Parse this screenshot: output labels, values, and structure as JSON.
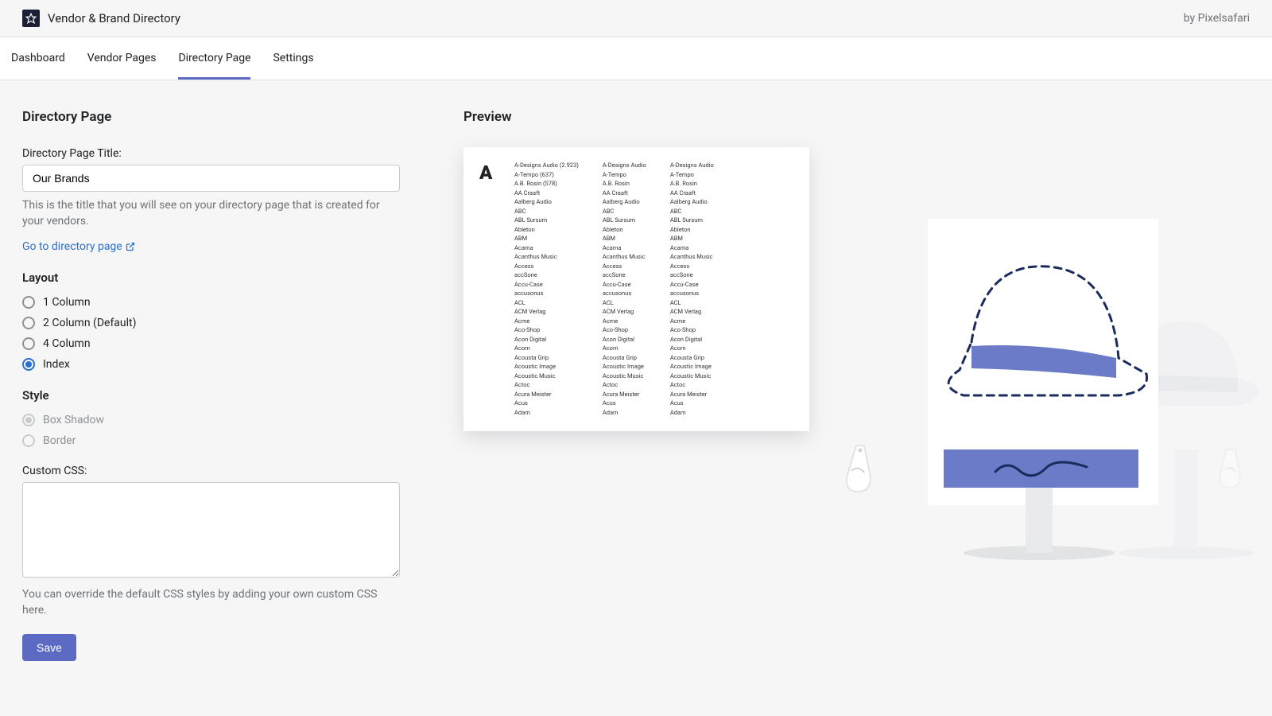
{
  "header": {
    "app_title": "Vendor & Brand Directory",
    "byline": "by Pixelsafari"
  },
  "tabs": [
    {
      "label": "Dashboard"
    },
    {
      "label": "Vendor Pages"
    },
    {
      "label": "Directory Page"
    },
    {
      "label": "Settings"
    }
  ],
  "active_tab": 2,
  "page": {
    "heading": "Directory Page",
    "title_label": "Directory Page Title:",
    "title_value": "Our Brands",
    "title_help": "This is the title that you will see on your directory page that is created for your vendors.",
    "go_link": "Go to directory page",
    "layout_heading": "Layout",
    "layout_options": [
      {
        "label": "1 Column",
        "checked": false
      },
      {
        "label": "2 Column (Default)",
        "checked": false
      },
      {
        "label": "4 Column",
        "checked": false
      },
      {
        "label": "Index",
        "checked": true
      }
    ],
    "style_heading": "Style",
    "style_options": [
      {
        "label": "Box Shadow",
        "checked": true,
        "disabled": true
      },
      {
        "label": "Border",
        "checked": false,
        "disabled": true
      }
    ],
    "css_label": "Custom CSS:",
    "css_value": "",
    "css_help": "You can override the default CSS styles by adding your own custom CSS here.",
    "save_label": "Save"
  },
  "preview": {
    "heading": "Preview",
    "letter": "A",
    "col1": [
      "A-Designs Audio (2.923)",
      "A-Tempo (637)",
      "A.B. Rosin (578)",
      "AA Craaft",
      "Aalberg Audio",
      "ABC",
      "ABL Sursum",
      "Ableton",
      "ABM",
      "Acama",
      "Acanthus Music",
      "Access",
      "accSone",
      "Accu-Case",
      "accusonus",
      "ACL",
      "ACM Verlag",
      "Acme",
      "Aco-Shop",
      "Acon Digital",
      "Acorn",
      "Acousta Grip",
      "Acoustic Image",
      "Acoustic Music",
      "Actoc",
      "Acura Meister",
      "Acus",
      "Adam"
    ],
    "col2": [
      "A-Designs Audio",
      "A-Tempo",
      "A.B. Rosin",
      "AA Craaft",
      "Aalberg Audio",
      "ABC",
      "ABL Sursum",
      "Ableton",
      "ABM",
      "Acama",
      "Acanthus Music",
      "Access",
      "accSone",
      "Accu-Case",
      "accusonus",
      "ACL",
      "ACM Verlag",
      "Acme",
      "Aco-Shop",
      "Acon Digital",
      "Acorn",
      "Acousta Grip",
      "Acoustic Image",
      "Acoustic Music",
      "Actoc",
      "Acura Meister",
      "Acus",
      "Adam"
    ],
    "col3": [
      "A-Designs Audio",
      "A-Tempo",
      "A.B. Rosin",
      "AA Craaft",
      "Aalberg Audio",
      "ABC",
      "ABL Sursum",
      "Ableton",
      "ABM",
      "Acama",
      "Acanthus Music",
      "Access",
      "accSone",
      "Accu-Case",
      "accusonus",
      "ACL",
      "ACM Verlag",
      "Acme",
      "Aco-Shop",
      "Acon Digital",
      "Acorn",
      "Acousta Grip",
      "Acoustic Image",
      "Acoustic Music",
      "Actoc",
      "Acura Meister",
      "Acus",
      "Adam"
    ]
  }
}
